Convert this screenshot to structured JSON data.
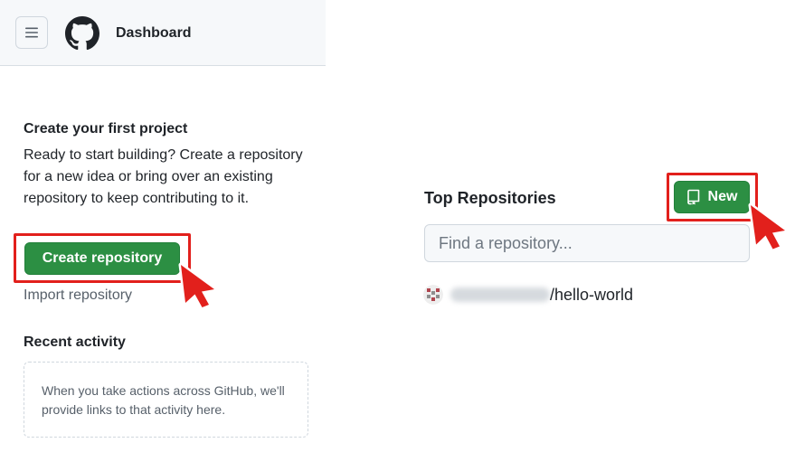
{
  "header": {
    "title": "Dashboard",
    "menu_icon": "hamburger-menu-icon",
    "logo_icon": "github-octocat-icon"
  },
  "intro": {
    "title": "Create your first project",
    "body": "Ready to start building? Create a repository for a new idea or bring over an existing repository to keep contributing to it.",
    "create_button": "Create repository",
    "import_link": "Import repository"
  },
  "recent_activity": {
    "title": "Recent activity",
    "empty_text": "When you take actions across GitHub, we'll provide links to that activity here."
  },
  "repositories": {
    "title": "Top Repositories",
    "new_button": "New",
    "new_icon": "repo-icon",
    "search_placeholder": "Find a repository...",
    "items": [
      {
        "name": "/hello-world"
      }
    ]
  },
  "annotations": {
    "highlight_color": "#e2201c",
    "cursor_icon": "pointer-arrow-icon"
  },
  "colors": {
    "primary_button": "#2c8f43",
    "header_bg": "#f6f8fa",
    "muted_text": "#57606a"
  }
}
